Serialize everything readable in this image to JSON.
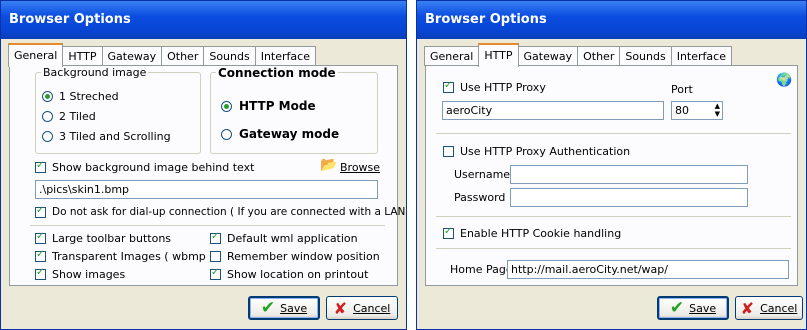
{
  "left": {
    "title": "Browser Options",
    "tabs": [
      "General",
      "HTTP",
      "Gateway",
      "Other",
      "Sounds",
      "Interface"
    ],
    "bg_group": {
      "title": "Background image",
      "options": [
        "1 Streched",
        "2 Tiled",
        "3 Tiled and Scrolling"
      ],
      "selected": 0
    },
    "conn_group": {
      "title": "Connection mode",
      "options": [
        "HTTP Mode",
        "Gateway mode"
      ],
      "selected": 0
    },
    "show_bg_text": "Show background image behind text",
    "show_bg_checked": true,
    "browse_label": "Browse",
    "bg_path": ".\\pics\\skin1.bmp",
    "dialup_text": "Do not ask for dial-up connection ( If you are connected with a LAN )",
    "dialup_checked": true,
    "options": [
      {
        "label": "Large toolbar buttons",
        "checked": true
      },
      {
        "label": "Default wml application",
        "checked": true
      },
      {
        "label": "Transparent Images ( wbmp )",
        "checked": true
      },
      {
        "label": "Remember window position",
        "checked": false
      },
      {
        "label": "Show images",
        "checked": true
      },
      {
        "label": "Show location on printout",
        "checked": true
      }
    ],
    "save_label": "Save",
    "cancel_label": "Cancel"
  },
  "right": {
    "title": "Browser Options",
    "tabs": [
      "General",
      "HTTP",
      "Gateway",
      "Other",
      "Sounds",
      "Interface"
    ],
    "use_proxy_text": "Use HTTP Proxy",
    "use_proxy_checked": true,
    "port_label": "Port",
    "proxy_host": "aeroCity",
    "port_value": "80",
    "use_auth_text": "Use HTTP Proxy Authentication",
    "use_auth_checked": false,
    "username_label": "Username",
    "password_label": "Password",
    "username_value": "",
    "password_value": "",
    "cookie_text": "Enable HTTP Cookie handling",
    "cookie_checked": true,
    "home_label": "Home Page",
    "home_value": "http://mail.aeroCity.net/wap/",
    "save_label": "Save",
    "cancel_label": "Cancel"
  }
}
